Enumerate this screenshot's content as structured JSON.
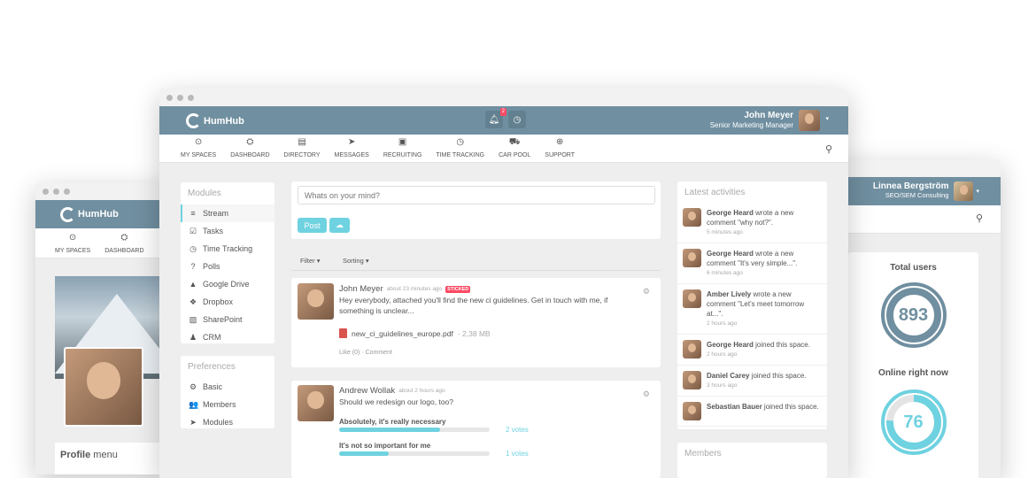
{
  "left_window": {
    "logo": "HumHub",
    "nav": [
      {
        "label": "MY SPACES",
        "icon": "target-icon",
        "dropdown": true
      },
      {
        "label": "DASHBOARD",
        "icon": "dashboard-icon"
      }
    ],
    "profile_menu": {
      "bold": "Profile",
      "rest": "menu"
    }
  },
  "main_window": {
    "logo": "HumHub",
    "notifications_count": "2",
    "user": {
      "name": "John Meyer",
      "title": "Senior Marketing Manager"
    },
    "nav": [
      {
        "label": "MY SPACES",
        "icon": "⊙",
        "dropdown": true
      },
      {
        "label": "DASHBOARD",
        "icon": "⛭"
      },
      {
        "label": "DIRECTORY",
        "icon": "▤"
      },
      {
        "label": "MESSAGES",
        "icon": "➤"
      },
      {
        "label": "RECRUITING",
        "icon": "▣"
      },
      {
        "label": "TIME TRACKING",
        "icon": "◷"
      },
      {
        "label": "CAR POOL",
        "icon": "⛟"
      },
      {
        "label": "SUPPORT",
        "icon": "⊕"
      }
    ],
    "modules": {
      "heading": "Modules",
      "items": [
        {
          "label": "Stream",
          "icon": "≡",
          "active": true
        },
        {
          "label": "Tasks",
          "icon": "☑"
        },
        {
          "label": "Time Tracking",
          "icon": "◷"
        },
        {
          "label": "Polls",
          "icon": "?"
        },
        {
          "label": "Google Drive",
          "icon": "▲"
        },
        {
          "label": "Dropbox",
          "icon": "❖"
        },
        {
          "label": "SharePoint",
          "icon": "▨"
        },
        {
          "label": "CRM",
          "icon": "♟"
        }
      ]
    },
    "preferences": {
      "heading": "Preferences",
      "items": [
        {
          "label": "Basic",
          "icon": "⚙"
        },
        {
          "label": "Members",
          "icon": "👥"
        },
        {
          "label": "Modules",
          "icon": "➤"
        }
      ]
    },
    "composer": {
      "placeholder": "Whats on your mind?",
      "post_label": "Post",
      "upload_icon": "cloud-upload-icon"
    },
    "filter": {
      "filter_label": "Filter",
      "sorting_label": "Sorting"
    },
    "posts": [
      {
        "author": "John Meyer",
        "time": "about 23 minutes ago",
        "badge": "STICKED",
        "text": "Hey everybody, attached you'll find the new ci guidelines. Get in touch with me, if something is unclear...",
        "file_name": "new_ci_guidelines_europe.pdf",
        "file_size": "- 2,38 MB",
        "like": "Like (0)",
        "comment": "· Comment"
      },
      {
        "author": "Andrew Wollak",
        "time": "about 2 hours ago",
        "text": "Should we redesign our logo, too?",
        "poll": [
          {
            "label": "Absolutely, it's really necessary",
            "votes": "2 votes",
            "fraction": 0.67
          },
          {
            "label": "It's not so important for me",
            "votes": "1 votes",
            "fraction": 0.33
          }
        ]
      }
    ],
    "activities": {
      "heading": "Latest activities",
      "items": [
        {
          "name": "George Heard",
          "text": " wrote a new comment \"why not?\".",
          "time": "5 minutes ago"
        },
        {
          "name": "George Heard",
          "text": " wrote a new comment \"It's very simple...\".",
          "time": "6 minutes ago"
        },
        {
          "name": "Amber Lively",
          "text": " wrote a new comment \"Let's meet tomorrow at...\".",
          "time": "2 hours ago"
        },
        {
          "name": "George Heard",
          "text": " joined this space.",
          "time": "2 hours ago"
        },
        {
          "name": "Daniel Carey",
          "text": " joined this space.",
          "time": "3 hours ago"
        },
        {
          "name": "Sebastian Bauer",
          "text": " joined this space.",
          "time": ""
        }
      ]
    },
    "members_heading": "Members"
  },
  "right_window": {
    "user": {
      "name": "Linnea Bergström",
      "title": "SEO/SEM Consulting"
    },
    "total_users_label": "Total users",
    "total_users": "893",
    "online_label": "Online right now",
    "online": "76",
    "online_fraction": 0.76,
    "colors": {
      "gauge_gray": "#708fa0",
      "gauge_teal": "#6fd2e0"
    }
  },
  "colors": {
    "topbar": "#708fa0",
    "accent": "#6fd2e0",
    "badge": "#fc4a64"
  }
}
